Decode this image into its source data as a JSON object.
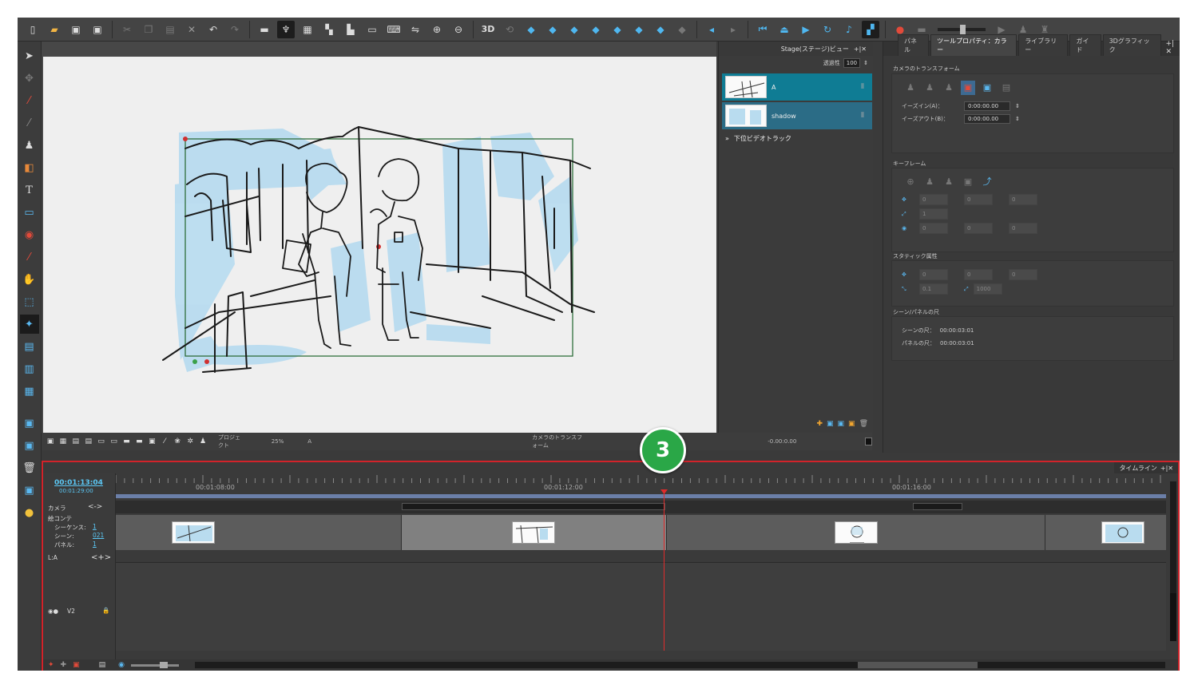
{
  "toolbar": {
    "items": [
      "new-icon",
      "open-folder-icon",
      "save-icon",
      "save-all-icon",
      "cut-icon",
      "copy-icon",
      "paste-icon",
      "delete-icon",
      "undo-icon",
      "redo-icon",
      "strip-icon",
      "light-table-icon",
      "grid-icon",
      "panel-layout-icon",
      "split-icon",
      "frame-icon",
      "keyboard-icon",
      "flip-icon",
      "zoom-in-icon",
      "zoom-out-icon"
    ],
    "label_3d": "3D"
  },
  "stage": {
    "zoom": "25%",
    "project_label": "プロジェクト",
    "layer_label": "A",
    "transform_label": "カメラのトランスフォーム",
    "coord_readout": "-0.00:0.00"
  },
  "layer_panel": {
    "title": "Stage(ステージ)ビュー",
    "opacity_label": "透過性",
    "opacity_value": "100",
    "layers": [
      {
        "name": "A"
      },
      {
        "name": "shadow"
      }
    ],
    "lower_track": "下位ビデオトラック"
  },
  "props": {
    "tabs": [
      "パネル",
      "ツールプロパティ：カラー",
      "ライブラリー",
      "ガイド",
      "3Dグラフィック"
    ],
    "active_tab": 1,
    "camera_section": "カメラのトランスフォーム",
    "ease_in_label": "イーズイン(A)：",
    "ease_in_value": "0:00:00.00",
    "ease_out_label": "イーズアウト(B)：",
    "ease_out_value": "0:00:00.00",
    "keyframe_section": "キーフレーム",
    "kf_fields": [
      "0",
      "0",
      "0"
    ],
    "kf_scale": "1",
    "kf_rot": [
      "0",
      "0",
      "0"
    ],
    "static_section": "スタティック属性",
    "st_fields": [
      "0",
      "0",
      "0"
    ],
    "st_a": "0.1",
    "st_b": "1000",
    "scene_section": "シーン/パネルの尺",
    "scene_len_label": "シーンの尺：",
    "scene_len_value": "00:00:03:01",
    "panel_len_label": "パネルの尺：",
    "panel_len_value": "00:00:03:01"
  },
  "timeline": {
    "title": "タイムライン",
    "current_time": "00:01:13:04",
    "total_time": "00:01:29:00",
    "ruler": [
      "00:01:08:00",
      "00:01:12:00",
      "00:01:16:00"
    ],
    "camera_label": "カメラ",
    "storyboard_label": "絵コンテ",
    "sequence_label": "シーケンス:",
    "sequence_value": "1",
    "scene_label": "シーン:",
    "scene_value": "021",
    "panel_label": "パネル:",
    "panel_value": "1",
    "la_label": "L:A",
    "v2_label": "V2"
  },
  "step_badge": "3",
  "colors": {
    "accent_blue": "#4fb7f0",
    "timeline_border": "#d2232a",
    "badge_green": "#2aa747",
    "layer_selected": "#0f7c94"
  }
}
